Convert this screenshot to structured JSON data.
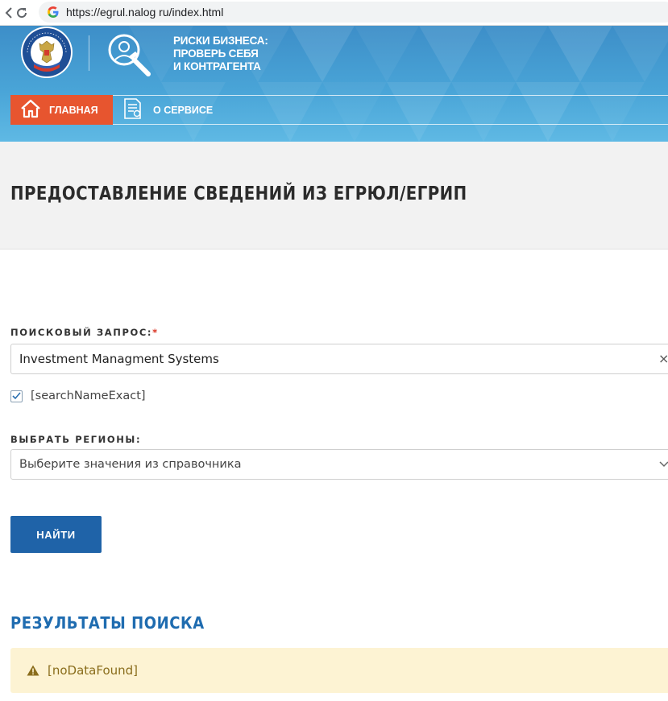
{
  "browser": {
    "url": "https://egrul.nalog ru/index.html"
  },
  "header": {
    "emblem_text": "ФЕДЕРАЛЬНАЯ НАЛОГОВАЯ СЛУЖБА",
    "service_title": [
      "РИСКИ БИЗНЕСА:",
      "ПРОВЕРЬ СЕБЯ",
      "И КОНТРАГЕНТА"
    ],
    "nav": {
      "home_label": "ГЛАВНАЯ",
      "about_label": "О СЕРВИСЕ"
    }
  },
  "page": {
    "title": "ПРЕДОСТАВЛЕНИЕ СВЕДЕНИЙ ИЗ ЕГРЮЛ/ЕГРИП"
  },
  "form": {
    "query_label": "ПОИСКОВЫЙ ЗАПРОС:",
    "query_required_mark": "*",
    "query_value": "Investment Managment Systems",
    "clear_glyph": "×",
    "exact_checked": true,
    "exact_label": "[searchNameExact]",
    "regions_label": "ВЫБРАТЬ РЕГИОНЫ:",
    "regions_placeholder": "Выберите значения из справочника",
    "submit_label": "НАЙТИ"
  },
  "results": {
    "title": "РЕЗУЛЬТАТЫ ПОИСКА",
    "message": "[noDataFound]"
  },
  "colors": {
    "banner": "#49a4d7",
    "home_tab": "#e7552f",
    "primary_button": "#1f63a8",
    "results_title": "#1f6cb0",
    "alert_bg": "#fdf3d3",
    "alert_text": "#8a6d1c"
  },
  "icons": {
    "reload": "reload-icon",
    "google": "google-icon",
    "emblem": "fns-emblem-icon",
    "service": "magnifier-wrench-icon",
    "home": "home-icon",
    "about": "document-icon",
    "check": "checkmark-icon",
    "chevron": "chevron-down-icon",
    "warning": "warning-icon"
  }
}
